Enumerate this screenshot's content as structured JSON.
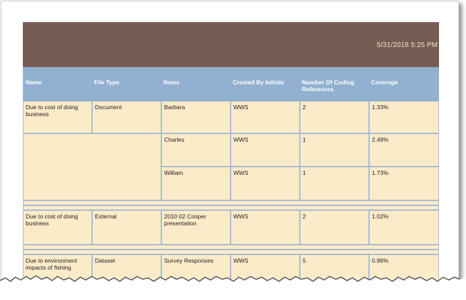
{
  "report": {
    "timestamp": "5/31/2018 5:25 PM"
  },
  "table": {
    "headers": [
      "Name",
      "File Type",
      "Name",
      "Created By Initials",
      "Number Of Coding References",
      "Coverage"
    ],
    "groups": [
      {
        "name": "Due to cost of doing business",
        "file_type": "Document",
        "rows": [
          {
            "name": "Barbara",
            "initials": "WWS",
            "refs": "2",
            "coverage": "1.33%"
          },
          {
            "name": "Charles",
            "initials": "WWS",
            "refs": "1",
            "coverage": "2.49%"
          },
          {
            "name": "William",
            "initials": "WWS",
            "refs": "1",
            "coverage": "1.73%"
          }
        ]
      },
      {
        "name": "Due to cost of doing business",
        "file_type": "External",
        "rows": [
          {
            "name": "2010 02 Cooper presentation",
            "initials": "WWS",
            "refs": "2",
            "coverage": "1.02%"
          }
        ]
      },
      {
        "name": "Due to environment impacts of fishing",
        "file_type": "Dataset",
        "rows": [
          {
            "name": "Survey Responses",
            "initials": "WWS",
            "refs": "5",
            "coverage": "0.96%"
          }
        ]
      }
    ]
  },
  "colors": {
    "banner": "#765c52",
    "header": "#92b0cf",
    "cell": "#fcebc9",
    "border": "#a9bcd0"
  }
}
